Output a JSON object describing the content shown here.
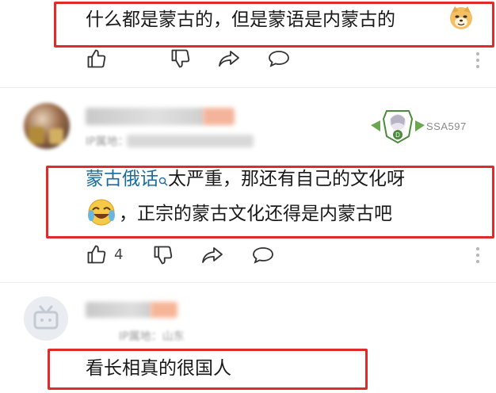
{
  "comments": [
    {
      "text": "什么都是蒙古的，但是蒙语是内蒙古的",
      "emoji": "doge-emoji"
    },
    {
      "user_badge_text": "SSA597",
      "location_meta": "IP属地：",
      "mention_link": "蒙古俄话",
      "text_line1": "太严重，那还有自己的文化呀",
      "text_line2": "，正宗的蒙古文化还得是内蒙古吧",
      "emoji": "laughing-tears-emoji",
      "like_count": "4"
    },
    {
      "location_meta": "IP属地：山东",
      "text": "看长相真的很国人"
    }
  ],
  "icons": {
    "like": "thumbs-up-icon",
    "dislike": "thumbs-down-icon",
    "share": "share-arrow-icon",
    "reply": "comment-bubble-icon",
    "more": "more-vertical-icon"
  },
  "colors": {
    "highlight_border": "#e02b2b",
    "mention_link": "#1a6e9e",
    "badge_green": "#4b8b3b"
  }
}
